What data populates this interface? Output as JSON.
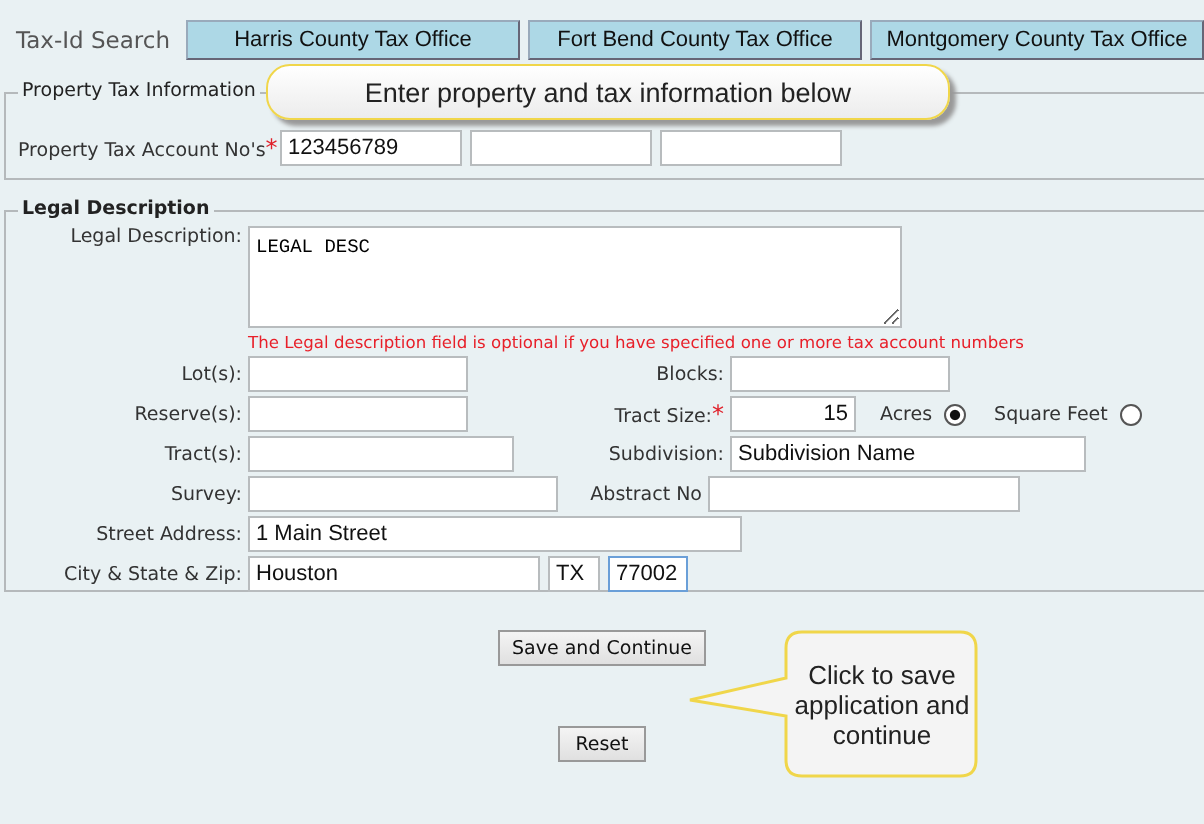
{
  "header": {
    "title": "Tax-Id Search",
    "offices": [
      {
        "label": "Harris County Tax Office"
      },
      {
        "label": "Fort Bend County Tax Office"
      },
      {
        "label": "Montgomery County Tax Office"
      }
    ]
  },
  "required_mark": "*",
  "property_tax": {
    "legend": "Property Tax Information",
    "callout": "Enter property and tax information below",
    "account_label": "Property Tax Account No's",
    "required": true,
    "accounts": [
      "123456789"
    ]
  },
  "legal": {
    "legend": "Legal Description",
    "description_label": "Legal Description:",
    "description": "LEGAL DESC",
    "note": "The Legal description field is optional if you have specified one or more tax account numbers",
    "lots_label": "Lot(s):",
    "blocks_label": "Blocks:",
    "reserves_label": "Reserve(s):",
    "tract_size_label": "Tract Size:",
    "tract_size_required": true,
    "tract_size": "15",
    "units": [
      {
        "label": "Acres",
        "selected": true
      },
      {
        "label": "Square Feet",
        "selected": false
      }
    ],
    "tracts_label": "Tract(s):",
    "subdivision_label": "Subdivision:",
    "subdivision": "Subdivision Name",
    "survey_label": "Survey:",
    "abstract_label": "Abstract No",
    "street_label": "Street Address:",
    "street": "1 Main Street",
    "city_label": "City & State & Zip:",
    "city": "Houston",
    "state": "TX",
    "zip": "77002"
  },
  "actions": {
    "save": "Save and Continue",
    "save_callout": "Click to save application and continue",
    "reset": "Reset"
  }
}
